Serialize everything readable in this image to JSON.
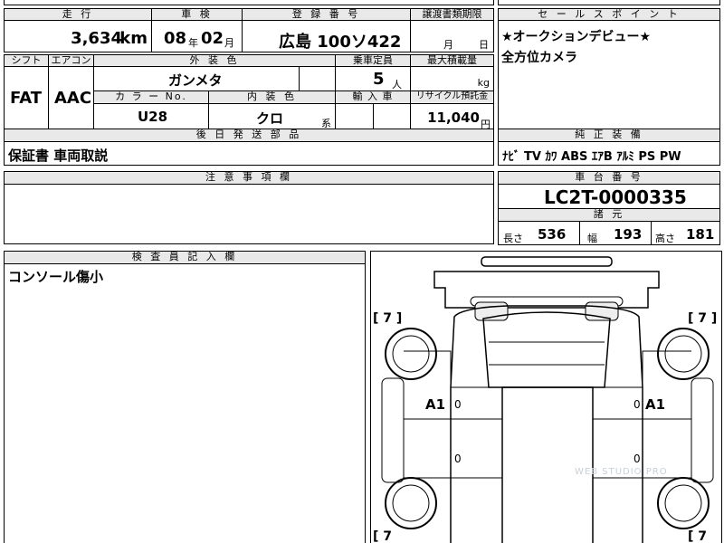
{
  "header": {
    "mileage_label": "走 行",
    "shaken_label": "車 検",
    "registration_label": "登 録 番 号",
    "transfer_label": "譲渡書類期限",
    "sales_point_label": "セ ー ル ス ポ イ ン ト"
  },
  "vehicle": {
    "mileage_value": "3,634",
    "mileage_unit": "km",
    "shaken_year": "08",
    "shaken_year_unit": "年",
    "shaken_month": "02",
    "shaken_month_unit": "月",
    "registration": "広島 100ソ422",
    "transfer_month": "月",
    "transfer_day": "日"
  },
  "sales_points": [
    "★オークションデビュー★",
    "全方位カメラ"
  ],
  "row2": {
    "shift_label": "シフト",
    "aircon_label": "エアコン",
    "exterior_color_label": "外 装 色",
    "capacity_label": "乗車定員",
    "max_load_label": "最大積載量",
    "shift_value": "FAT",
    "aircon_value": "AAC",
    "exterior_color_value": "ガンメタ",
    "capacity_value": "5",
    "capacity_unit": "人",
    "max_load_unit": "kg",
    "color_no_label": "カ ラ ー No.",
    "interior_color_label": "内 装 色",
    "import_label": "輸 入 車",
    "recycle_label": "リサイクル預託金",
    "color_no_value": "U28",
    "interior_color_value": "クロ",
    "interior_suffix": "系",
    "recycle_value": "11,040",
    "recycle_unit": "円"
  },
  "equipment": {
    "label": "純 正 装 備",
    "items": "ﾅﾋﾞ TV ｶﾜ ABS ｴｱB ｱﾙﾐ PS PW"
  },
  "later_parts": {
    "label": "後 日 発 送 部 品",
    "value": "保証書 車両取説"
  },
  "notes": {
    "label": "注 意 事 項 欄",
    "value": ""
  },
  "chassis": {
    "label": "車 台 番 号",
    "value": "LC2T-0000335"
  },
  "dimensions": {
    "label": "諸 元",
    "length_label": "長さ",
    "length_value": "536",
    "width_label": "幅",
    "width_value": "193",
    "height_label": "高さ",
    "height_value": "181"
  },
  "inspector": {
    "label": "検 査 員 記 入 欄",
    "note": "コンソール傷小"
  },
  "diagram": {
    "tire_front_left": "[ 7 ]",
    "tire_front_right": "[ 7 ]",
    "tire_rear_left": "[ 7",
    "tire_rear_right": "[ 7",
    "mark_left_door": "A1",
    "mark_right_door": "A1",
    "zero": "0",
    "watermark": "WEB STUDIO PRO"
  }
}
